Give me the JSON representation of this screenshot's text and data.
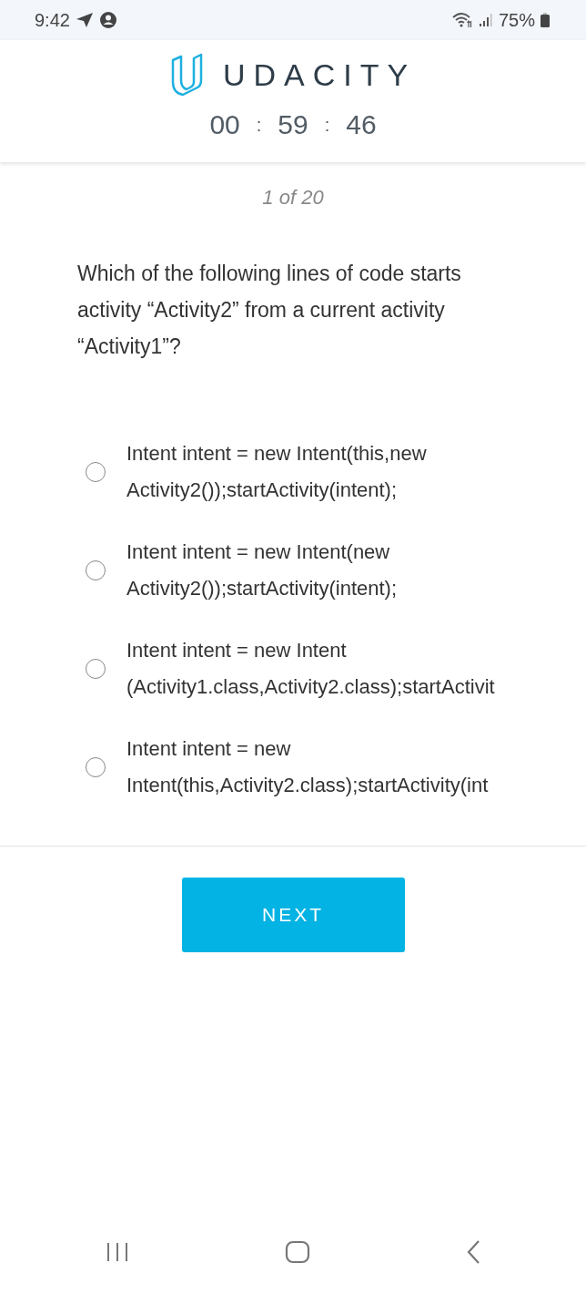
{
  "status_bar": {
    "time": "9:42",
    "battery": "75%"
  },
  "header": {
    "brand": "UDACITY",
    "timer": [
      {
        "kind": "digits",
        "text": "00"
      },
      {
        "kind": "separator",
        "text": ":"
      },
      {
        "kind": "digits",
        "text": "59"
      },
      {
        "kind": "separator",
        "text": ":"
      },
      {
        "kind": "digits",
        "text": "46"
      }
    ]
  },
  "quiz": {
    "progress": "1 of 20",
    "question": "Which of the following lines of code starts activity “Activity2” from a current activity “Activity1”?",
    "options": [
      {
        "lines": [
          "Intent intent = new Intent(this,new",
          "Activity2());startActivity(intent);"
        ],
        "selected": false
      },
      {
        "lines": [
          "Intent intent = new Intent(new",
          "Activity2());startActivity(intent);"
        ],
        "selected": false
      },
      {
        "lines": [
          "Intent intent = new Intent",
          "(Activity1.class,Activity2.class);startActivit"
        ],
        "selected": false
      },
      {
        "lines": [
          "Intent intent = new",
          "Intent(this,Activity2.class);startActivity(int"
        ],
        "selected": false
      }
    ],
    "next_button": "NEXT"
  }
}
